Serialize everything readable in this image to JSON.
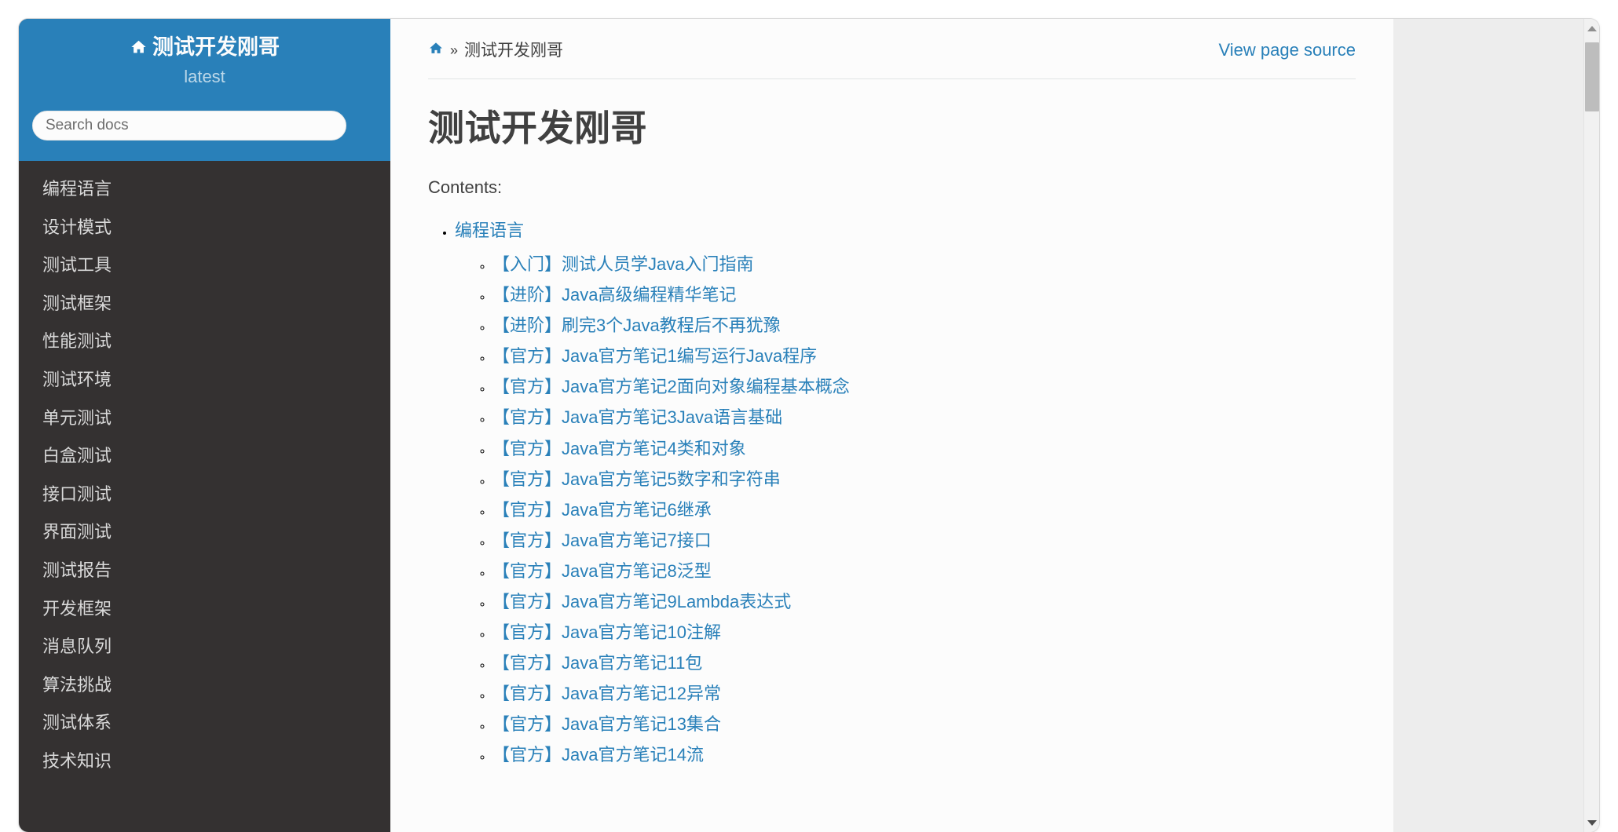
{
  "sidebar": {
    "brand": {
      "home_icon": "home-icon",
      "title": "测试开发刚哥",
      "version": "latest"
    },
    "search": {
      "placeholder": "Search docs",
      "value": ""
    },
    "nav_items": [
      {
        "label": "编程语言"
      },
      {
        "label": "设计模式"
      },
      {
        "label": "测试工具"
      },
      {
        "label": "测试框架"
      },
      {
        "label": "性能测试"
      },
      {
        "label": "测试环境"
      },
      {
        "label": "单元测试"
      },
      {
        "label": "白盒测试"
      },
      {
        "label": "接口测试"
      },
      {
        "label": "界面测试"
      },
      {
        "label": "测试报告"
      },
      {
        "label": "开发框架"
      },
      {
        "label": "消息队列"
      },
      {
        "label": "算法挑战"
      },
      {
        "label": "测试体系"
      },
      {
        "label": "技术知识"
      }
    ]
  },
  "breadcrumb": {
    "home_icon": "home-icon",
    "separator": "»",
    "current": "测试开发刚哥"
  },
  "header": {
    "view_source_label": "View page source"
  },
  "main": {
    "title": "测试开发刚哥",
    "contents_label": "Contents:",
    "toctree": [
      {
        "label": "编程语言",
        "children": [
          {
            "label": "【入门】测试人员学Java入门指南"
          },
          {
            "label": "【进阶】Java高级编程精华笔记"
          },
          {
            "label": "【进阶】刷完3个Java教程后不再犹豫"
          },
          {
            "label": "【官方】Java官方笔记1编写运行Java程序"
          },
          {
            "label": "【官方】Java官方笔记2面向对象编程基本概念"
          },
          {
            "label": "【官方】Java官方笔记3Java语言基础"
          },
          {
            "label": "【官方】Java官方笔记4类和对象"
          },
          {
            "label": "【官方】Java官方笔记5数字和字符串"
          },
          {
            "label": "【官方】Java官方笔记6继承"
          },
          {
            "label": "【官方】Java官方笔记7接口"
          },
          {
            "label": "【官方】Java官方笔记8泛型"
          },
          {
            "label": "【官方】Java官方笔记9Lambda表达式"
          },
          {
            "label": "【官方】Java官方笔记10注解"
          },
          {
            "label": "【官方】Java官方笔记11包"
          },
          {
            "label": "【官方】Java官方笔记12异常"
          },
          {
            "label": "【官方】Java官方笔记13集合"
          },
          {
            "label": "【官方】Java官方笔记14流"
          }
        ]
      }
    ]
  },
  "scrollbar": {
    "up_icon": "chevron-up-icon",
    "down_icon": "chevron-down-icon"
  },
  "colors": {
    "sidebar_search_bg": "#2980b9",
    "sidebar_bg": "#343131",
    "link": "#2980b9",
    "text": "#404040",
    "content_bg": "#fcfcfc",
    "gutter_bg": "#ededed"
  }
}
